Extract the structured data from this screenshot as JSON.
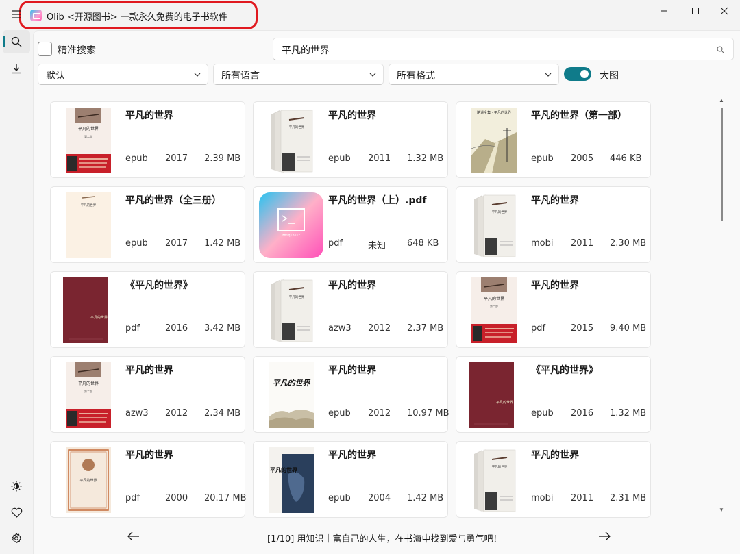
{
  "window": {
    "title": "Olib <开源图书> 一款永久免费的电子书软件",
    "controls": {
      "minimize": "—",
      "maximize": "☐",
      "close": "✕"
    }
  },
  "rail": {
    "top_icons": [
      "menu-icon",
      "search-icon",
      "download-icon"
    ],
    "bottom_icons": [
      "theme-icon",
      "heart-icon",
      "settings-icon"
    ],
    "accent": "#0f7b8a"
  },
  "toolbar": {
    "exact_search_label": "精准搜索",
    "exact_search_checked": false,
    "search_value": "平凡的世界",
    "sort_value": "默认",
    "language_value": "所有语言",
    "format_value": "所有格式",
    "large_view_label": "大图",
    "large_view_on": true
  },
  "books": [
    {
      "title": "平凡的世界",
      "format": "epub",
      "year": "2017",
      "size": "2.39 MB",
      "cover": "red-band"
    },
    {
      "title": "平凡的世界",
      "format": "epub",
      "year": "2011",
      "size": "1.32 MB",
      "cover": "boxset"
    },
    {
      "title": "平凡的世界（第一部）",
      "format": "epub",
      "year": "2005",
      "size": "446 KB",
      "cover": "sketch"
    },
    {
      "title": "平凡的世界（全三册）",
      "format": "epub",
      "year": "2017",
      "size": "1.42 MB",
      "cover": "plain"
    },
    {
      "title": "平凡的世界（上）.pdf",
      "format": "pdf",
      "year": "未知",
      "size": "648 KB",
      "cover": "app"
    },
    {
      "title": "平凡的世界",
      "format": "mobi",
      "year": "2011",
      "size": "2.30 MB",
      "cover": "boxset"
    },
    {
      "title": "《平凡的世界》",
      "format": "pdf",
      "year": "2016",
      "size": "3.42 MB",
      "cover": "maroon"
    },
    {
      "title": "平凡的世界",
      "format": "azw3",
      "year": "2012",
      "size": "2.37 MB",
      "cover": "boxset"
    },
    {
      "title": "平凡的世界",
      "format": "pdf",
      "year": "2015",
      "size": "9.40 MB",
      "cover": "red-band"
    },
    {
      "title": "平凡的世界",
      "format": "azw3",
      "year": "2012",
      "size": "2.34 MB",
      "cover": "red-band"
    },
    {
      "title": "平凡的世界",
      "format": "epub",
      "year": "2012",
      "size": "10.97 MB",
      "cover": "calligraphy"
    },
    {
      "title": "《平凡的世界》",
      "format": "epub",
      "year": "2016",
      "size": "1.32 MB",
      "cover": "maroon"
    },
    {
      "title": "平凡的世界",
      "format": "pdf",
      "year": "2000",
      "size": "20.17 MB",
      "cover": "classic"
    },
    {
      "title": "平凡的世界",
      "format": "epub",
      "year": "2004",
      "size": "1.42 MB",
      "cover": "blue"
    },
    {
      "title": "平凡的世界",
      "format": "mobi",
      "year": "2011",
      "size": "2.31 MB",
      "cover": "boxset"
    }
  ],
  "cover_texts": {
    "book_title": "平凡的世界",
    "series_title": "路遥全集 · 平凡的世界",
    "volume": "第二部",
    "app_label": "zhiqibuit"
  },
  "footer": {
    "text": "[1/10] 用知识丰富自己的人生，在书海中找到爱与勇气吧！",
    "prev": "←",
    "next": "→"
  },
  "colors": {
    "accent": "#0f7b8a",
    "highlight": "#e0191f",
    "maroon_cover": "#7a2530",
    "red_band": "#c8202a"
  }
}
